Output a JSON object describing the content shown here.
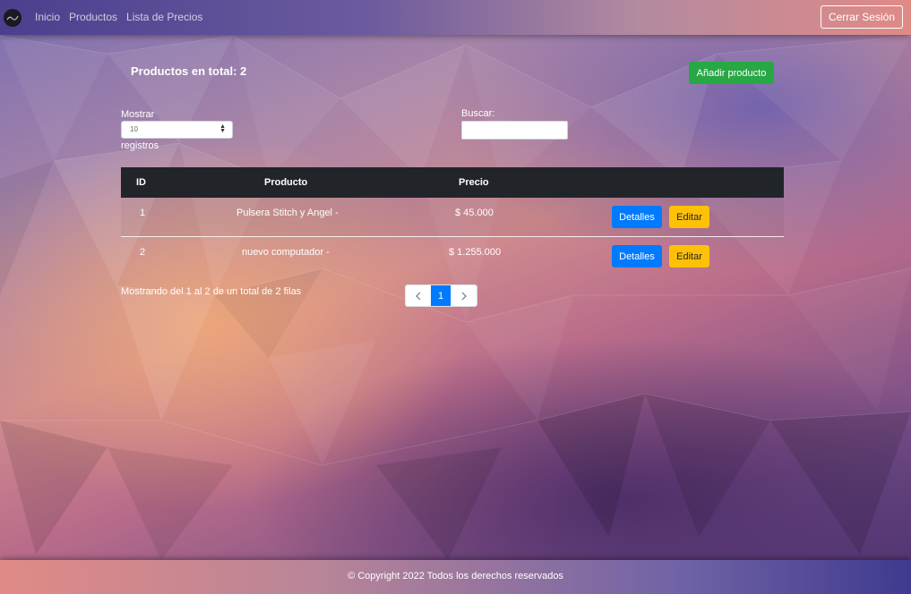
{
  "navbar": {
    "links": [
      "Inicio",
      "Productos",
      "Lista de Precios"
    ],
    "logout_label": "Cerrar Sesión"
  },
  "main": {
    "total_title": "Productos en total: 2",
    "add_label": "Añadir producto",
    "length_label_top": "Mostrar",
    "length_value": "10",
    "length_label_bottom": "registros",
    "search_label": "Buscar:",
    "search_value": ""
  },
  "table": {
    "headers": [
      "ID",
      "Producto",
      "Precio"
    ],
    "rows": [
      {
        "id": "1",
        "producto": "Pulsera Stitch y Angel -",
        "precio": "$ 45.000"
      },
      {
        "id": "2",
        "producto": "nuevo computador -",
        "precio": "$ 1.255.000"
      }
    ],
    "details_label": "Detalles",
    "edit_label": "Editar"
  },
  "pagination": {
    "info": "Mostrando del 1 al 2 de un total de 2 filas",
    "current_page": "1",
    "prev_icon": "chevron-left-icon",
    "next_icon": "chevron-right-icon"
  },
  "footer": {
    "copyright": "© Copyright 2022 Todos los derechos reservados"
  },
  "colors": {
    "success": "#28a745",
    "primary": "#007bff",
    "warning": "#ffc107",
    "table_header": "#212529"
  }
}
